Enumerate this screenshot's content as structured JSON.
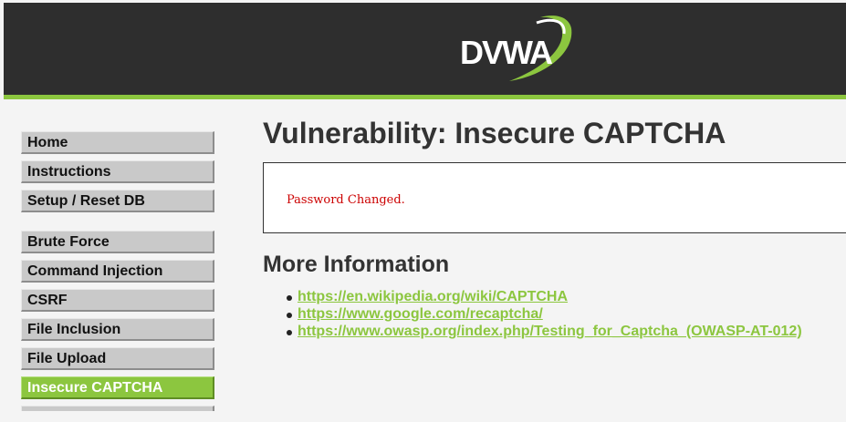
{
  "header": {
    "logo_text": "DVWA",
    "colors": {
      "background": "#2e2e2e",
      "accent": "#8cc63f"
    }
  },
  "sidebar": {
    "group1": [
      {
        "label": "Home"
      },
      {
        "label": "Instructions"
      },
      {
        "label": "Setup / Reset DB"
      }
    ],
    "group2": [
      {
        "label": "Brute Force"
      },
      {
        "label": "Command Injection"
      },
      {
        "label": "CSRF"
      },
      {
        "label": "File Inclusion"
      },
      {
        "label": "File Upload"
      },
      {
        "label": "Insecure CAPTCHA",
        "active": true
      }
    ]
  },
  "main": {
    "title": "Vulnerability: Insecure CAPTCHA",
    "message": "Password Changed.",
    "more_info_title": "More Information",
    "links": [
      {
        "label": "https://en.wikipedia.org/wiki/CAPTCHA"
      },
      {
        "label": "https://www.google.com/recaptcha/"
      },
      {
        "label": "https://www.owasp.org/index.php/Testing_for_Captcha_(OWASP-AT-012)"
      }
    ]
  },
  "colors": {
    "link": "#8cc63f",
    "message": "#cc0000",
    "active_menu": "#8cc63f"
  }
}
